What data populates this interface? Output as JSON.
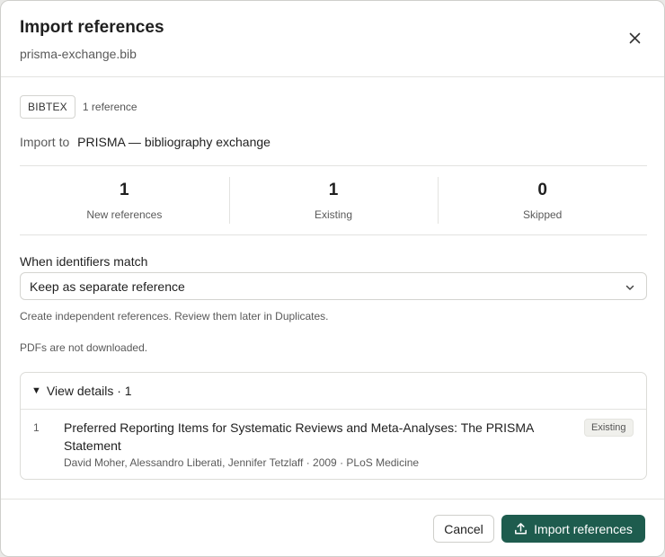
{
  "dialog": {
    "title": "Import references",
    "filename": "prisma-exchange.bib"
  },
  "source": {
    "format_badge": "BIBTEX",
    "reference_count": "1 reference",
    "import_to_label": "Import to",
    "import_to_value": "PRISMA — bibliography exchange"
  },
  "stats": [
    {
      "value": "1",
      "label": "New references"
    },
    {
      "value": "1",
      "label": "Existing"
    },
    {
      "value": "0",
      "label": "Skipped"
    }
  ],
  "duplicate_handling": {
    "label": "When identifiers match",
    "selected": "Keep as separate reference",
    "help": "Create independent references. Review them later in Duplicates."
  },
  "pdf_note": "PDFs are not downloaded.",
  "details": {
    "summary": "View details · 1",
    "items": [
      {
        "index": "1",
        "title": "Preferred Reporting Items for Systematic Reviews and Meta-Analyses: The PRISMA Statement",
        "meta": "David Moher, Alessandro Liberati, Jennifer Tetzlaff · 2009 · PLoS Medicine",
        "status": "Existing"
      }
    ]
  },
  "footer": {
    "cancel_label": "Cancel",
    "import_label": "Import references"
  },
  "icons": {
    "close": "close-icon",
    "chevron": "chevron-down-icon",
    "caret": "caret-down-icon",
    "upload": "upload-icon"
  },
  "colors": {
    "primary": "#1e5c4e",
    "border": "#e3e3e0",
    "muted_text": "#5a5a5a"
  }
}
